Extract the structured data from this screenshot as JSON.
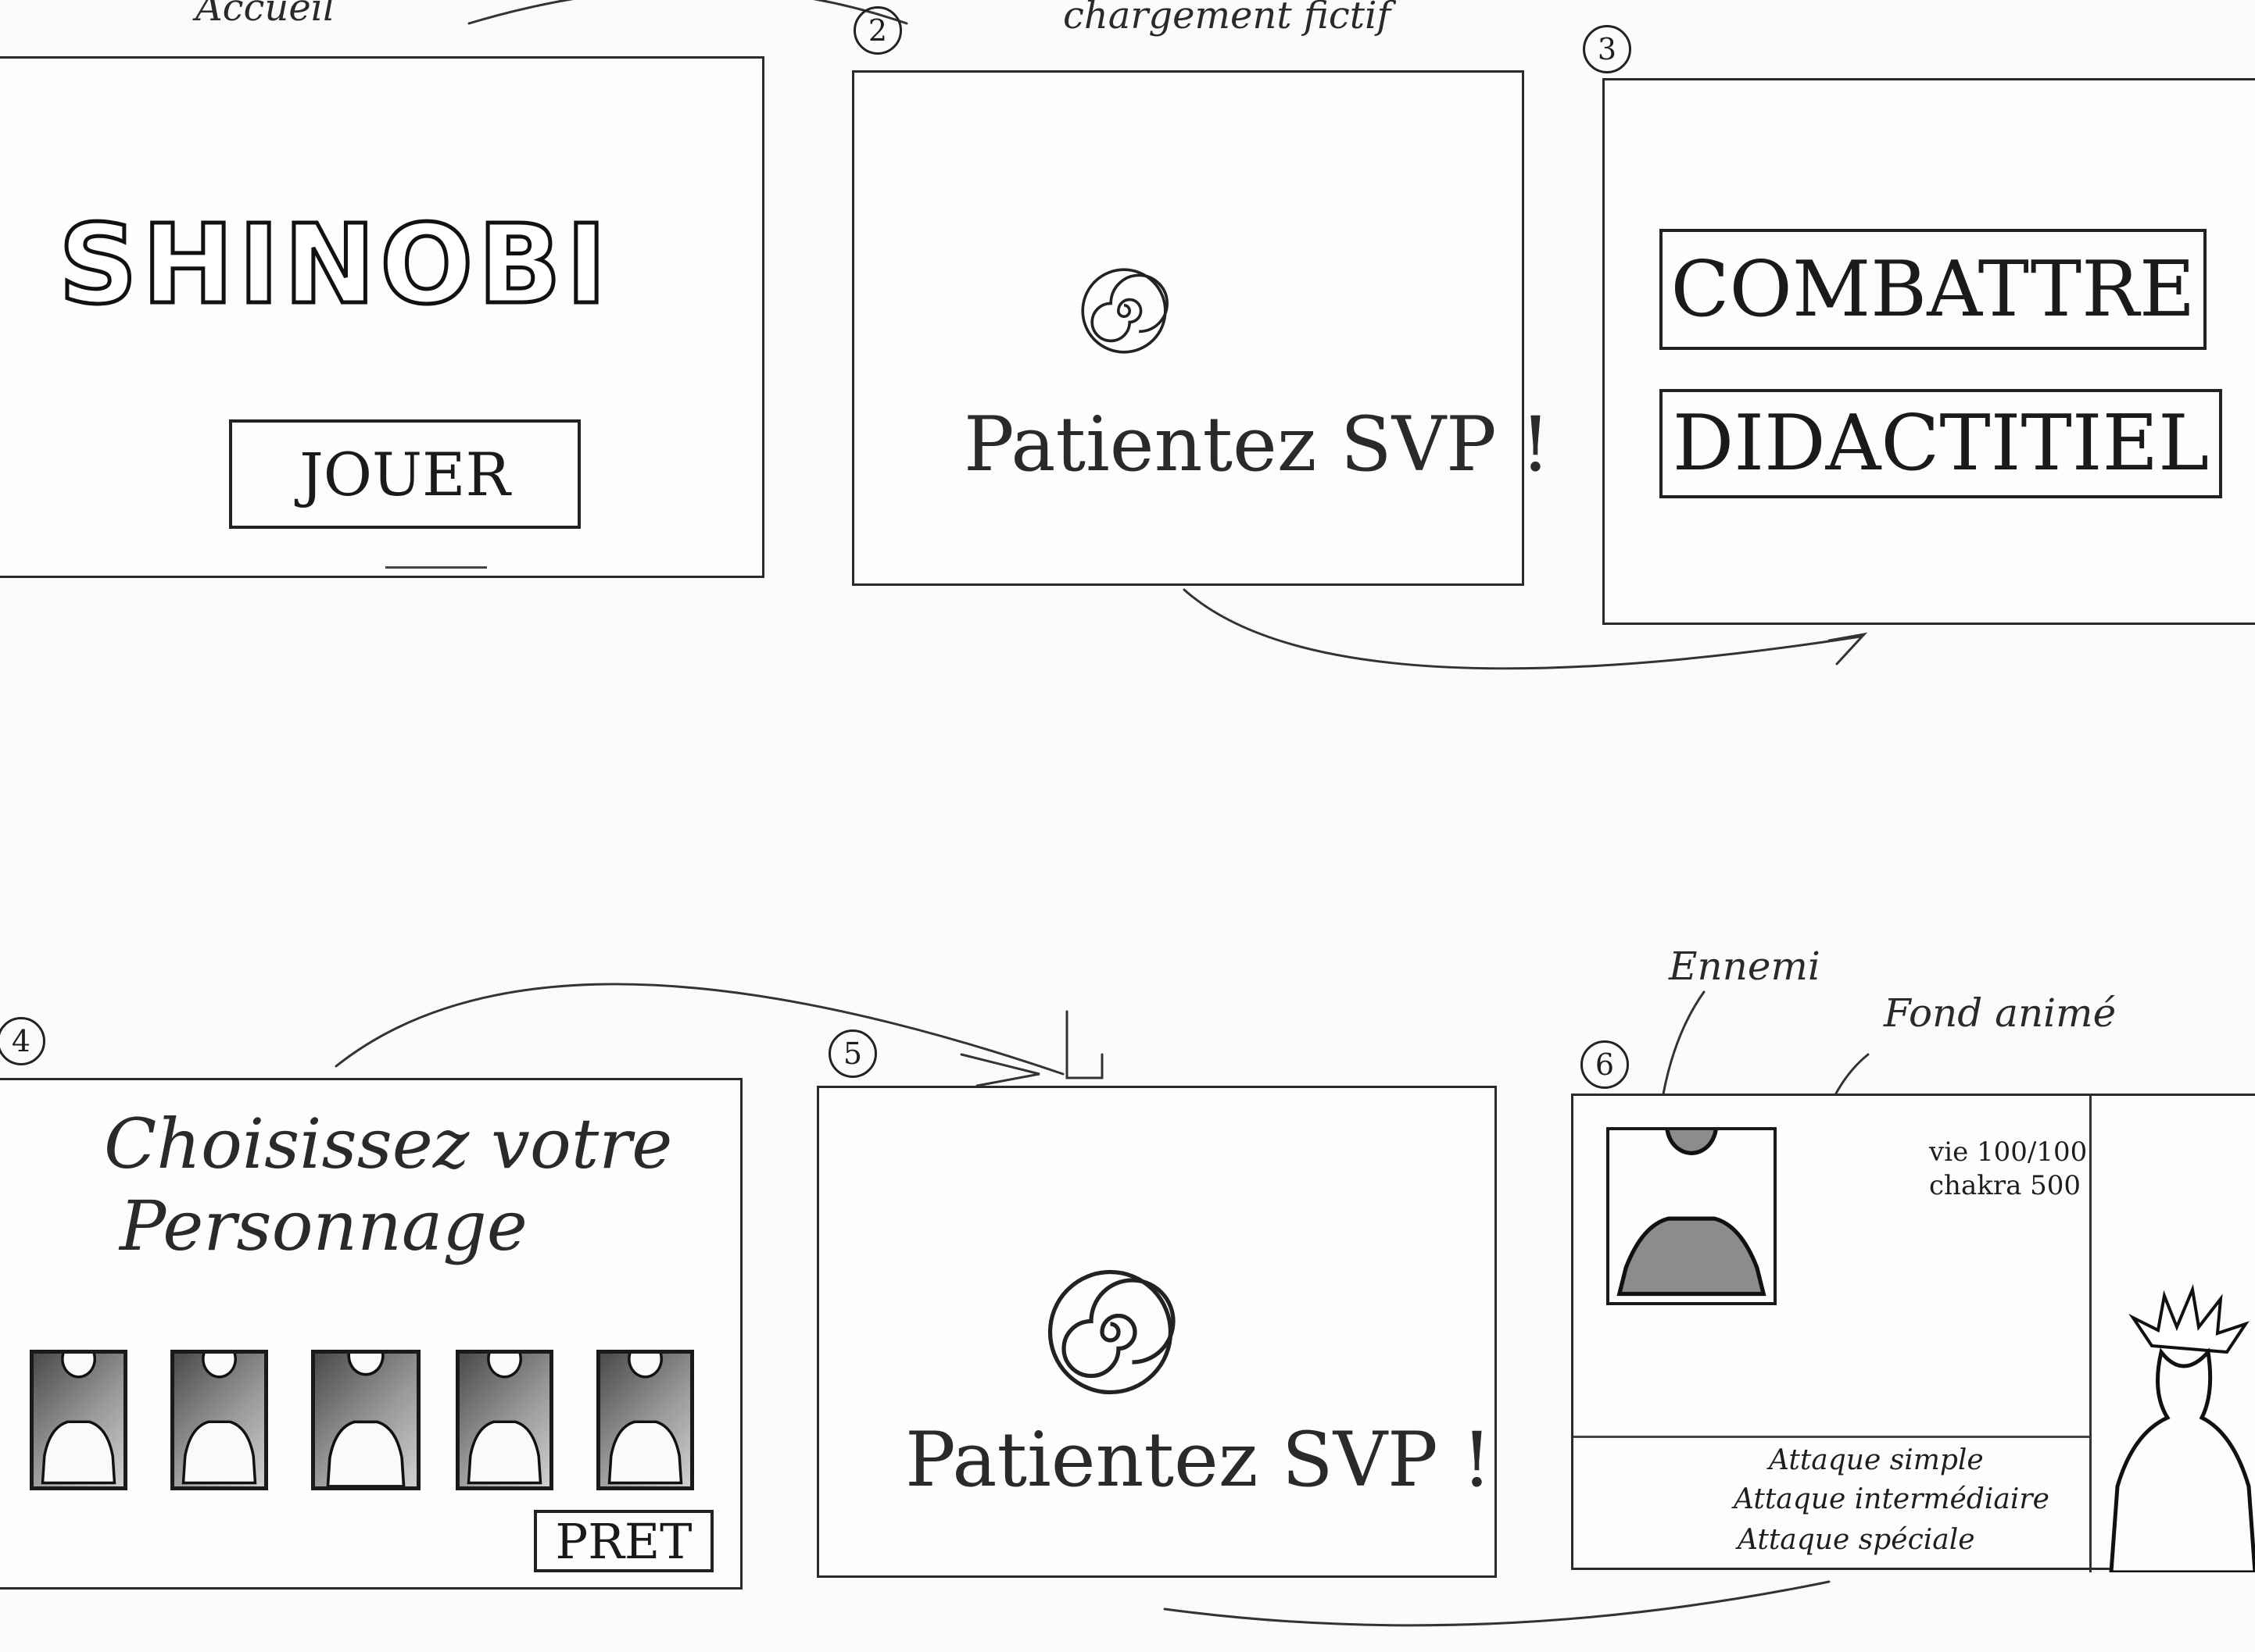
{
  "step_numbers": [
    "2",
    "3",
    "4",
    "5",
    "6"
  ],
  "screen1": {
    "label": "Accueil",
    "logo": "SHINOBI",
    "play_button": "JOUER"
  },
  "screen2": {
    "label": "chargement fictif",
    "loading_text": "Patientez SVP !",
    "spinner_icon": "spiral-icon"
  },
  "screen3": {
    "fight_button": "COMBATTRE",
    "tutorial_button": "DIDACTITIEL"
  },
  "screen4": {
    "title_line1": "Choisissez votre",
    "title_line2": "Personnage",
    "characters": [
      {
        "icon": "character-silhouette-icon"
      },
      {
        "icon": "character-silhouette-icon"
      },
      {
        "icon": "character-silhouette-icon"
      },
      {
        "icon": "character-silhouette-icon"
      },
      {
        "icon": "character-silhouette-icon"
      }
    ],
    "ready_button": "PRET"
  },
  "screen5": {
    "loading_text": "Patientez SVP !",
    "spinner_icon": "spiral-icon"
  },
  "screen6": {
    "enemy_label": "Ennemi",
    "background_label": "Fond animé",
    "life": "vie 100/100",
    "chakra": "chakra 500",
    "attacks": [
      "Attaque simple",
      "Attaque intermédiaire",
      "Attaque spéciale"
    ]
  },
  "colors": {
    "pencil": "#1e1e1e",
    "paper": "#fbfbfa",
    "shading": "#8a8a8a"
  }
}
